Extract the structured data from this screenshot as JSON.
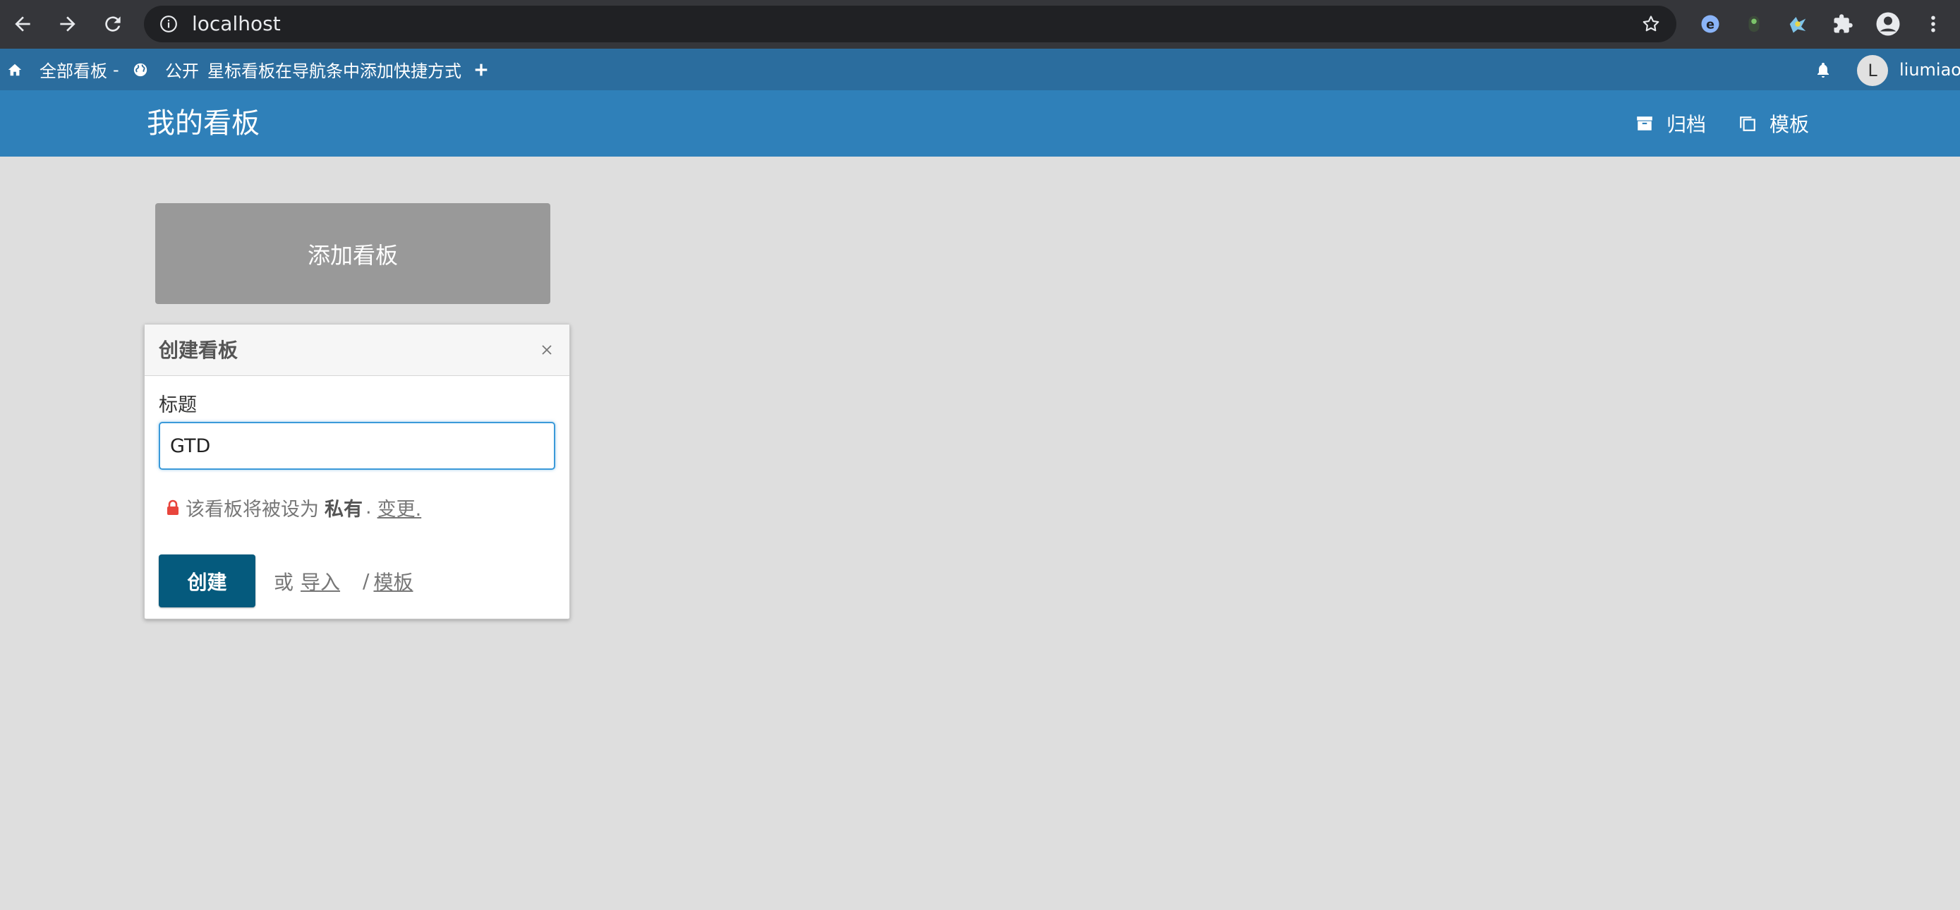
{
  "browser": {
    "url": "localhost"
  },
  "topbar": {
    "all_boards": "全部看板",
    "separator": "-",
    "public": "公开",
    "starred_hint": "星标看板在导航条中添加快捷方式",
    "user_initial": "L",
    "username": "liumiao"
  },
  "header": {
    "title": "我的看板",
    "archive_label": "归档",
    "templates_label": "模板"
  },
  "add_board": {
    "label": "添加看板"
  },
  "create_popup": {
    "title": "创建看板",
    "field_label": "标题",
    "title_value": "GTD",
    "privacy_prefix": "该看板将被设为",
    "privacy_value": "私有",
    "privacy_dot": ".",
    "privacy_change": "变更.",
    "create_button": "创建",
    "or_text": "或",
    "import_link": "导入",
    "slash": "/",
    "template_link": "模板"
  },
  "colors": {
    "topbar": "#2b6d9e",
    "header": "#2f80b9",
    "create_button": "#055a7d",
    "background": "#dedede"
  }
}
